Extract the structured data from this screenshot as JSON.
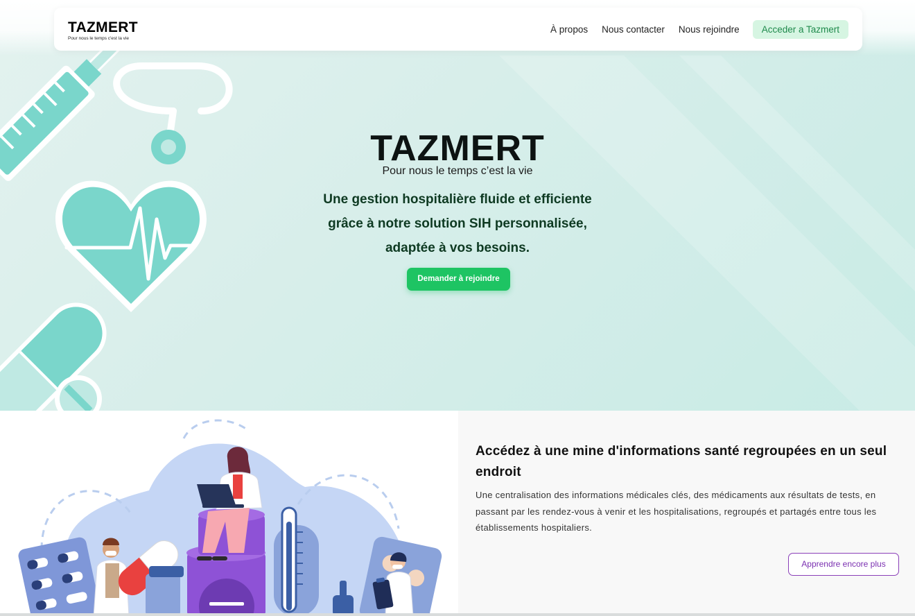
{
  "colors": {
    "accent_green": "#1ec463",
    "teal": "#7ad6cb",
    "cta_bg": "#d6f5e2",
    "cta_text": "#1f8a4c",
    "purple": "#8a3fb8"
  },
  "navbar": {
    "brand_name": "TAZMERT",
    "brand_tagline": "Pour nous le temps c'est la vie",
    "links": [
      "À propos",
      "Nous contacter",
      "Nous rejoindre"
    ],
    "cta_label": "Acceder a Tazmert"
  },
  "hero": {
    "title": "TAZMERT",
    "tagline": "Pour nous le temps c’est la vie",
    "lines": [
      "Une gestion hospitalière fluide et efficiente",
      "grâce à notre solution SIH personnalisée,",
      "adaptée à vos besoins."
    ],
    "button_label": "Demander à rejoindre"
  },
  "feature": {
    "title": "Accédez à une mine d'informations santé regroupées en un seul endroit",
    "text": "Une centralisation des informations médicales clés, des médicaments aux résultats de tests, en passant par les rendez-vous à venir et les hospitalisations, regroupés et partagés entre tous les établissements hospitaliers.",
    "button_label": "Apprendre encore plus"
  },
  "icons": {
    "hero": [
      "syringe-icon",
      "stethoscope-icon",
      "heart-pulse-icon",
      "pill-capsule-icon"
    ],
    "illustration": [
      "doctor-icon",
      "laptop-icon",
      "pill-pack-icon",
      "capsule-icon",
      "thermometer-icon",
      "clipboard-icon"
    ]
  }
}
